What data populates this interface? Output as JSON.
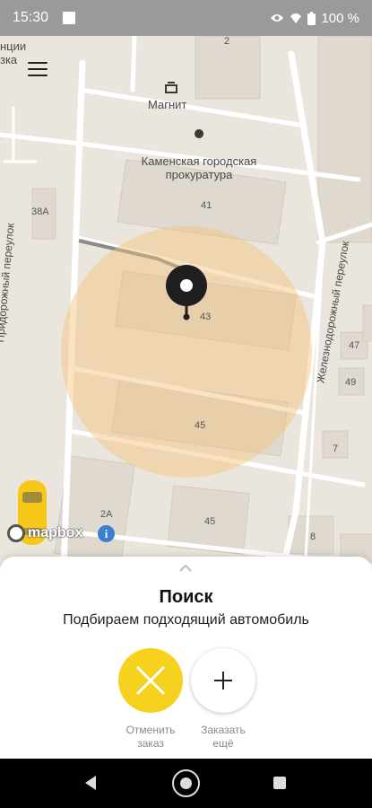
{
  "status_bar": {
    "time": "15:30",
    "battery": "100 %",
    "icons": [
      "notification-icon",
      "eye-icon",
      "wifi-icon",
      "battery-icon"
    ]
  },
  "map": {
    "labels": {
      "partial_top_left": "нции\nзка",
      "magnit": "Магнит",
      "prokuratura": "Каменская городская\nпрокуратура",
      "street_left": "Придорожный переулок",
      "street_right": "Железнодорожный переулок",
      "mapbox": "mapbox"
    },
    "buildings": {
      "b2": "2",
      "b38a": "38А",
      "b41": "41",
      "b43": "43",
      "b45a": "45",
      "b45b": "45",
      "b47": "47",
      "b49": "49",
      "b7": "7",
      "b8": "8",
      "b2a": "2А"
    },
    "colors": {
      "search_radius": "#f3c07a",
      "pin": "#1f1f1f",
      "taxi": "#f6c81a"
    }
  },
  "sheet": {
    "title": "Поиск",
    "subtitle": "Подбираем подходящий автомобиль",
    "cancel_label": "Отменить\nзаказ",
    "more_label": "Заказать\nещё",
    "accent": "#f6d11d"
  },
  "nav": {
    "icons": [
      "back-icon",
      "home-icon",
      "recents-icon"
    ]
  }
}
